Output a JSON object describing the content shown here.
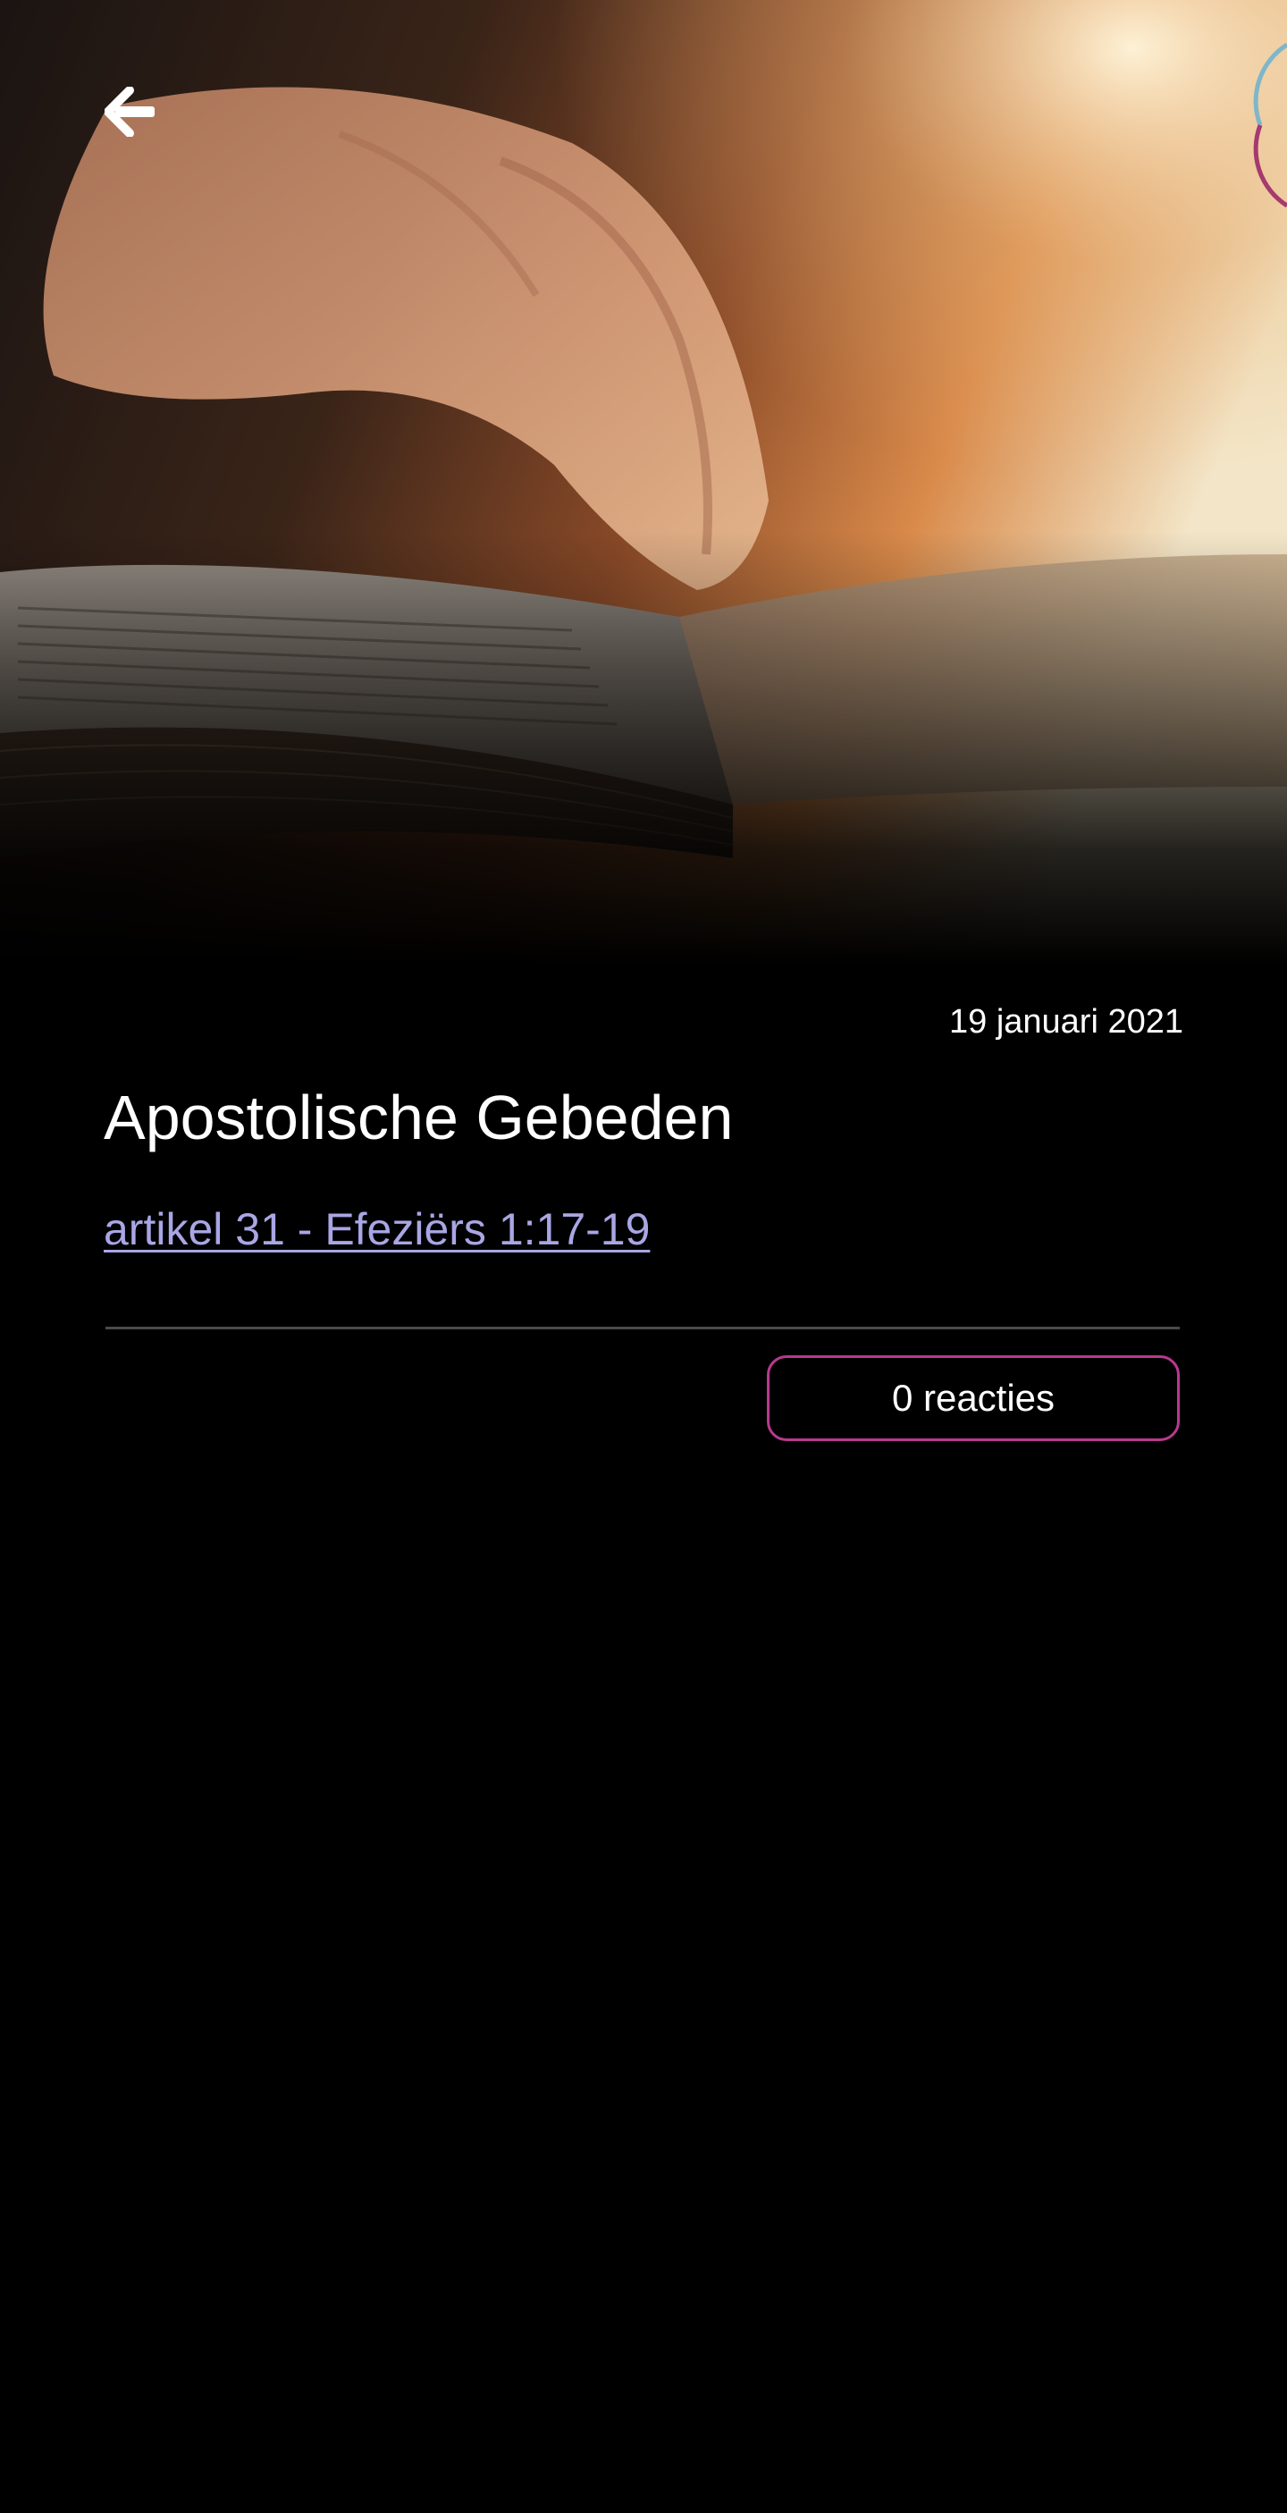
{
  "header": {
    "back_icon": "arrow-left-icon",
    "hero_image": "open bible with praying hands"
  },
  "article": {
    "date": "19 januari 2021",
    "title": "Apostolische Gebeden",
    "link_text": "artikel 31 - Efeziërs 1:17-19",
    "comments_label": "0 reacties"
  },
  "colors": {
    "background": "#000000",
    "link": "#a9a6e4",
    "accent_border": "#b8398e",
    "divider": "#4a4a4a"
  }
}
